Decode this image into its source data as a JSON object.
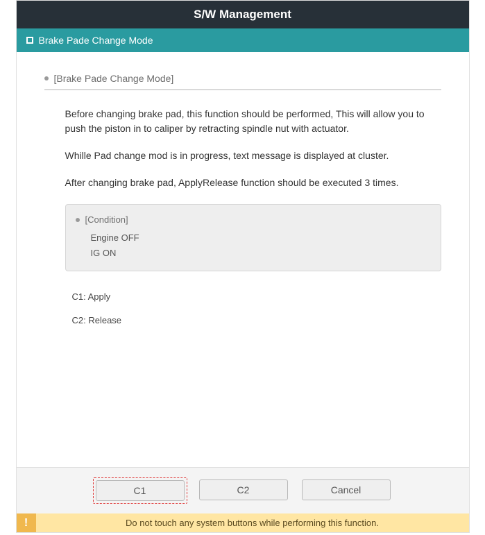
{
  "header": {
    "title": "S/W Management"
  },
  "subheader": {
    "label": "Brake Pade Change Mode"
  },
  "section": {
    "title": "[Brake Pade Change Mode]"
  },
  "description": {
    "p1": "Before changing brake pad, this function should be performed, This will allow you to push the piston in to caliper by retracting spindle nut with actuator.",
    "p2": "Whille Pad change mod is in progress, text message is displayed at cluster.",
    "p3": "After changing brake pad, ApplyRelease function should be executed 3 times."
  },
  "condition": {
    "title": "[Condition]",
    "items": [
      "Engine OFF",
      "IG ON"
    ]
  },
  "legend": {
    "c1": "C1: Apply",
    "c2": "C2: Release"
  },
  "buttons": {
    "c1": "C1",
    "c2": "C2",
    "cancel": "Cancel"
  },
  "warning": {
    "icon": "!",
    "text": "Do not touch any system buttons while performing this function."
  }
}
